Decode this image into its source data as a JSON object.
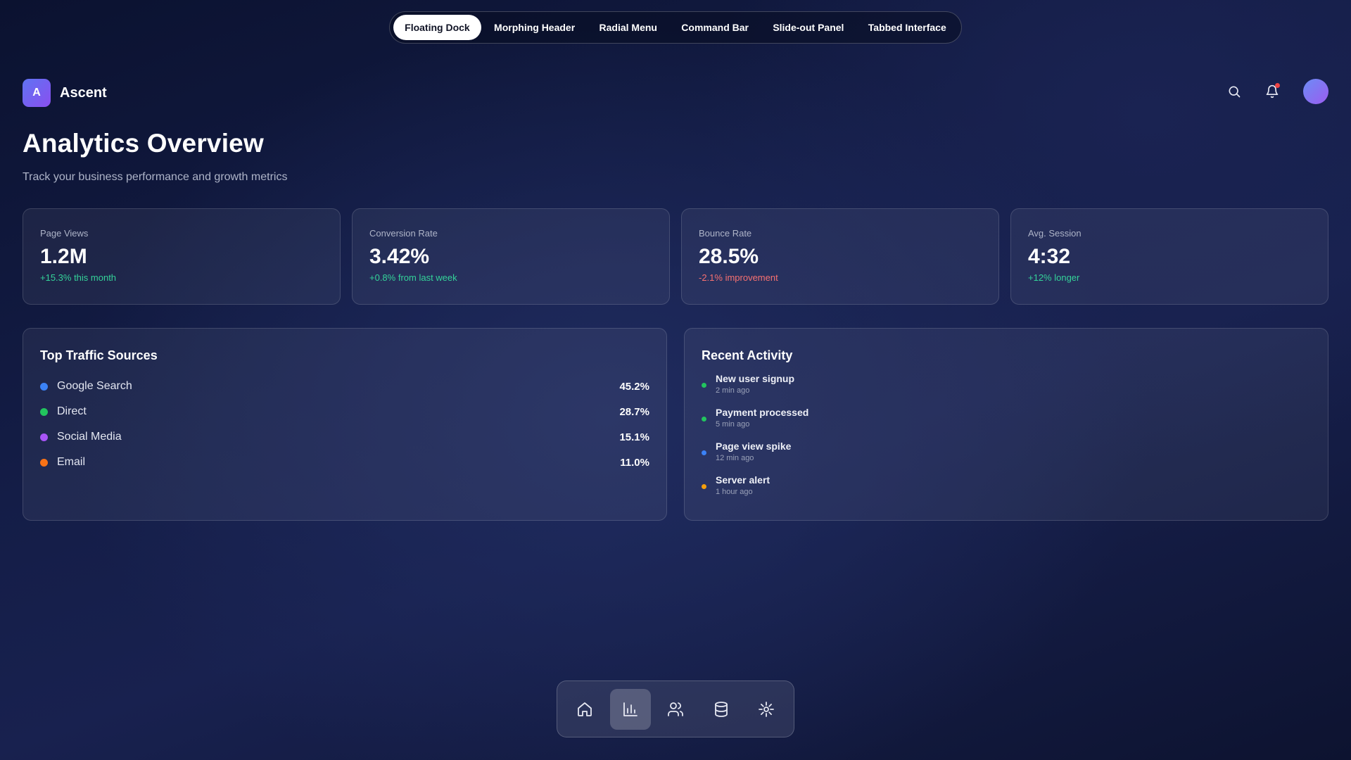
{
  "top_tabs": [
    {
      "label": "Floating Dock",
      "active": true
    },
    {
      "label": "Morphing Header"
    },
    {
      "label": "Radial Menu"
    },
    {
      "label": "Command Bar"
    },
    {
      "label": "Slide-out Panel"
    },
    {
      "label": "Tabbed Interface"
    }
  ],
  "brand": {
    "logo_letter": "A",
    "name": "Ascent"
  },
  "header": {
    "icons": [
      "search-icon",
      "bell-icon"
    ],
    "has_notification": true
  },
  "page": {
    "title": "Analytics Overview",
    "subtitle": "Track your business performance and growth metrics"
  },
  "stats": [
    {
      "label": "Page Views",
      "value": "1.2M",
      "change": "+15.3% this month",
      "trend": "positive"
    },
    {
      "label": "Conversion Rate",
      "value": "3.42%",
      "change": "+0.8% from last week",
      "trend": "positive"
    },
    {
      "label": "Bounce Rate",
      "value": "28.5%",
      "change": "-2.1% improvement",
      "trend": "negative"
    },
    {
      "label": "Avg. Session",
      "value": "4:32",
      "change": "+12% longer",
      "trend": "positive"
    }
  ],
  "traffic": {
    "title": "Top Traffic Sources",
    "sources": [
      {
        "name": "Google Search",
        "pct": "45.2%",
        "color": "#3b82f6"
      },
      {
        "name": "Direct",
        "pct": "28.7%",
        "color": "#22c55e"
      },
      {
        "name": "Social Media",
        "pct": "15.1%",
        "color": "#a855f7"
      },
      {
        "name": "Email",
        "pct": "11.0%",
        "color": "#f97316"
      }
    ]
  },
  "activity": {
    "title": "Recent Activity",
    "items": [
      {
        "title": "New user signup",
        "time": "2 min ago",
        "color": "#22c55e"
      },
      {
        "title": "Payment processed",
        "time": "5 min ago",
        "color": "#22c55e"
      },
      {
        "title": "Page view spike",
        "time": "12 min ago",
        "color": "#3b82f6"
      },
      {
        "title": "Server alert",
        "time": "1 hour ago",
        "color": "#f59e0b"
      }
    ]
  },
  "dock": {
    "items": [
      {
        "icon": "home-icon"
      },
      {
        "icon": "bar-chart-icon",
        "active": true
      },
      {
        "icon": "users-icon"
      },
      {
        "icon": "database-icon"
      },
      {
        "icon": "settings-icon"
      }
    ]
  },
  "colors": {
    "positive": "#34d399",
    "negative": "#f87171",
    "notification": "#ef4444",
    "brand_gradient": [
      "#5f73f2",
      "#8a4ff0"
    ]
  }
}
